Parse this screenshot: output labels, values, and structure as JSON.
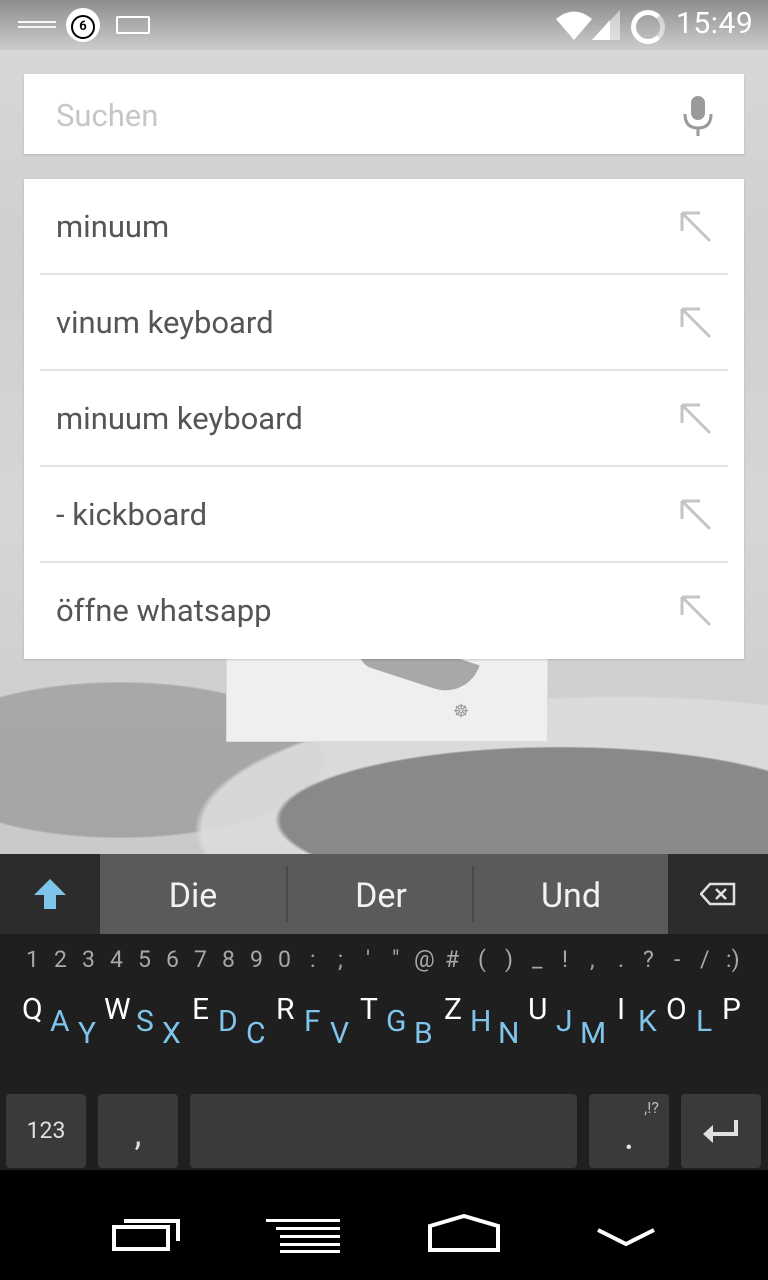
{
  "status_bar": {
    "notification_count": "6",
    "time": "15:49",
    "icons": [
      "notification-lines-icon",
      "chat-bubble-icon",
      "keyboard-icon",
      "wifi-icon",
      "signal-icon",
      "battery-icon"
    ]
  },
  "search": {
    "placeholder": "Suchen",
    "mic_icon": "microphone-icon"
  },
  "suggestions": [
    {
      "text": "minuum"
    },
    {
      "text": "vinum keyboard"
    },
    {
      "text": "minuum keyboard"
    },
    {
      "text": "- kickboard"
    },
    {
      "text": "öffne whatsapp"
    }
  ],
  "keyboard": {
    "word_suggestions": [
      "Die",
      "Der",
      "Und"
    ],
    "symbols": [
      "1",
      "2",
      "3",
      "4",
      "5",
      "6",
      "7",
      "8",
      "9",
      "0",
      ":",
      ";",
      "'",
      "\"",
      "@",
      "#",
      "(",
      ")",
      "_",
      "!",
      ",",
      ".",
      "?",
      "-",
      "/",
      ":)"
    ],
    "letters_top": [
      "Q",
      "W",
      "E",
      "R",
      "T",
      "Z",
      "U",
      "I",
      "O",
      "P"
    ],
    "letters_bottom": [
      "A",
      "Y",
      "S",
      "X",
      "D",
      "C",
      "F",
      "V",
      "G",
      "B",
      "H",
      "N",
      "J",
      "M",
      "K",
      "L"
    ],
    "key_123": "123",
    "key_comma": ",",
    "key_dot": ".",
    "key_dot_alt": ",!?",
    "colors": {
      "accent": "#7fc4ea",
      "suggestion_bar": "#5a5a5a",
      "keyboard_bg": "#1f1f1f"
    }
  },
  "nav_bar": {
    "icons": [
      "recent-apps-icon",
      "menu-icon",
      "home-icon",
      "back-down-icon"
    ]
  }
}
